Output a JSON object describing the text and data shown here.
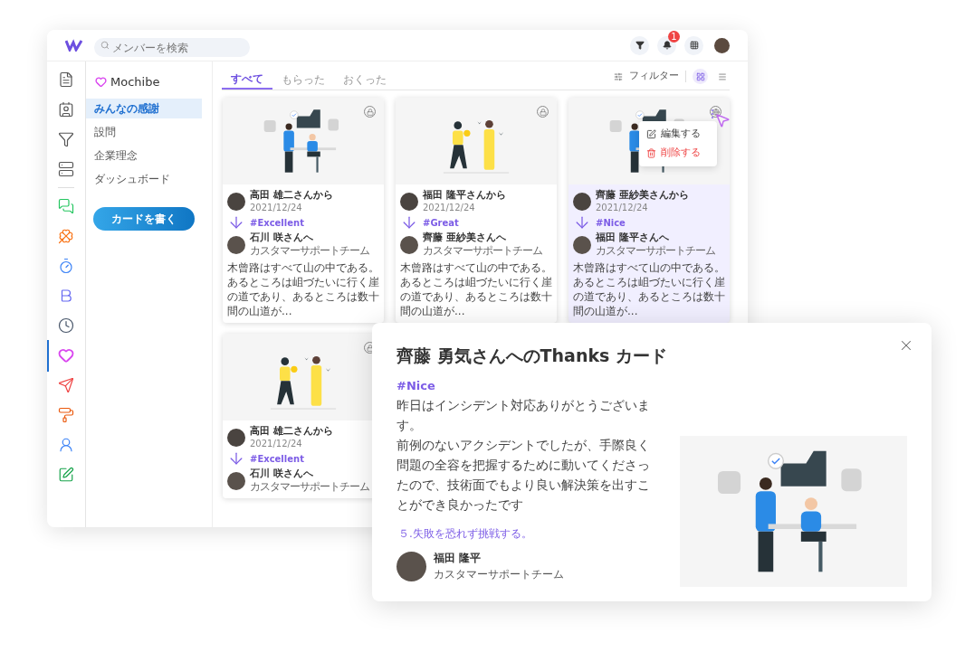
{
  "top_bar": {
    "search": {
      "placeholder": "メンバーを検索"
    },
    "notification_count": "1"
  },
  "rail": {
    "items": [
      {
        "selected": false
      },
      {
        "selected": false
      },
      {
        "selected": false
      },
      {
        "selected": false
      },
      {
        "selected": false
      },
      {
        "selected": false
      },
      {
        "selected": false
      },
      {
        "selected": false
      },
      {
        "selected": false
      },
      {
        "selected": true
      },
      {
        "selected": false
      },
      {
        "selected": false
      },
      {
        "selected": false
      },
      {
        "selected": false
      }
    ]
  },
  "sidebar": {
    "brand": "Mochibe",
    "items": [
      {
        "label": "みんなの感謝",
        "selected": true
      },
      {
        "label": "設問",
        "selected": false
      },
      {
        "label": "企業理念",
        "selected": false
      },
      {
        "label": "ダッシュボード",
        "selected": false
      }
    ],
    "button": "カードを書く"
  },
  "tabs": [
    {
      "label": "すべて",
      "selected": true
    },
    {
      "label": "もらった",
      "selected": false
    },
    {
      "label": "おくった",
      "selected": false
    }
  ],
  "toolbar": {
    "filter": "フィルター",
    "views": [
      {
        "kind": "grid",
        "selected": true
      },
      {
        "kind": "list",
        "selected": false
      }
    ]
  },
  "cards": [
    {
      "kind": "private",
      "selected": false,
      "from": "高田 雄二さんから",
      "date": "2021/12/24",
      "tag": "#Excellent",
      "to": "石川 咲さんへ",
      "team": "カスタマーサポートチーム",
      "excerpt": "木曾路はすべて山の中である。あるところは岨づたいに行く崖の道であり、あるところは数十間の山道が..."
    },
    {
      "kind": "private",
      "selected": false,
      "from": "福田 隆平さんから",
      "date": "2021/12/24",
      "tag": "#Great",
      "to": "齊藤 亜紗美さんへ",
      "team": "カスタマーサポートチーム",
      "excerpt": "木曾路はすべて山の中である。あるところは岨づたいに行く崖の道であり、あるところは数十間の山道が..."
    },
    {
      "kind": "public",
      "selected": true,
      "from": "齊藤 亜紗美さんから",
      "date": "2021/12/24",
      "tag": "#Nice",
      "to": "福田 隆平さんへ",
      "team": "カスタマーサポートチーム",
      "excerpt": "木曾路はすべて山の中である。あるところは岨づたいに行く崖の道であり、あるところは数十間の山道が..."
    },
    {
      "kind": "private",
      "selected": false,
      "from": "高田 雄二さんから",
      "date": "2021/12/24",
      "tag": "#Excellent",
      "to": "石川 咲さんへ",
      "team": "カスタマーサポートチーム"
    }
  ],
  "context_menu": {
    "items": [
      {
        "kind": "edit",
        "label": "編集する"
      },
      {
        "kind": "delete",
        "label": "削除する"
      }
    ]
  },
  "modal": {
    "title": "齊藤 勇気さんへのThanks カード",
    "tag": "#Nice",
    "paragraphs": [
      "昨日はインシデント対応ありがとうございます。",
      "前例のないアクシデントでしたが、手際良く問題の全容を把握するために動いてくださったので、技術面でもより良い解決策を出すことができ良かったです"
    ],
    "value": "５.失敗を恐れず挑戦する。",
    "sender": "福田 隆平",
    "team": "カスタマーサポートチーム"
  }
}
